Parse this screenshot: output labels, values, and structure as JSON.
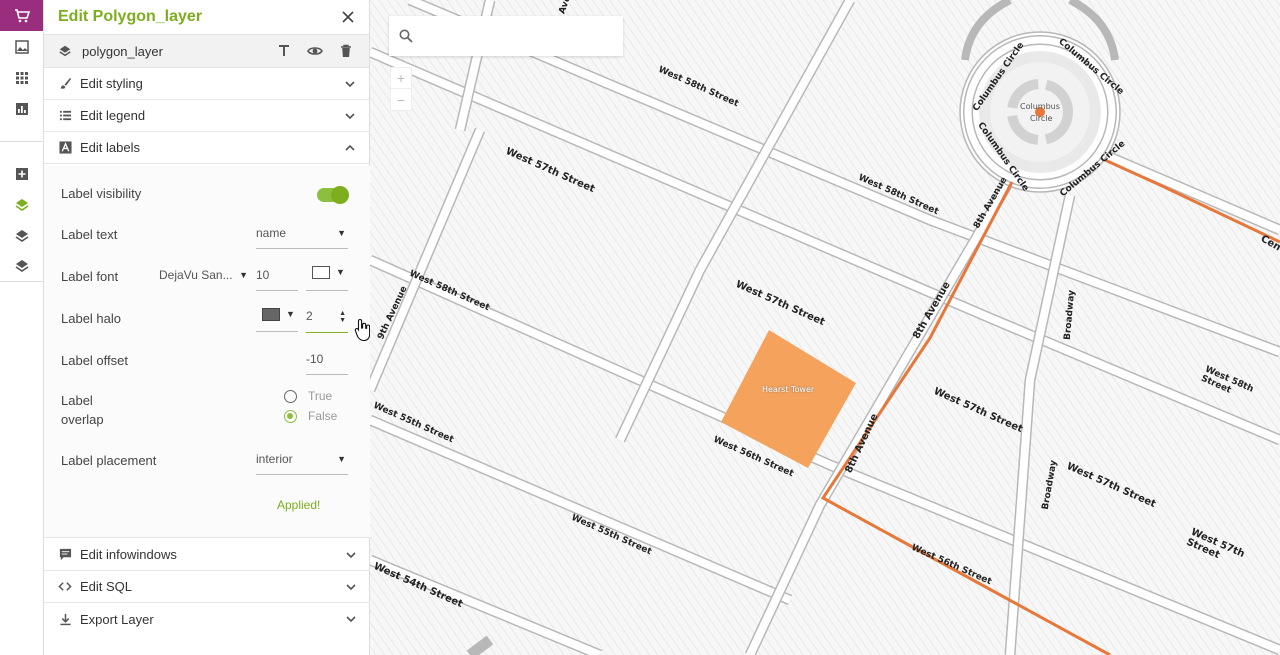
{
  "panel": {
    "title": "Edit Polygon_layer",
    "layer_name": "polygon_layer",
    "sections": {
      "styling": "Edit styling",
      "legend": "Edit legend",
      "labels": "Edit labels",
      "infowindows": "Edit infowindows",
      "sql": "Edit SQL",
      "export": "Export Layer"
    },
    "labels_form": {
      "visibility_label": "Label visibility",
      "text_label": "Label text",
      "text_value": "name",
      "font_label": "Label font",
      "font_family": "DejaVu San...",
      "font_size": "10",
      "halo_label": "Label halo",
      "halo_value": "2",
      "offset_label": "Label offset",
      "offset_value": "-10",
      "overlap_label_1": "Label",
      "overlap_label_2": "overlap",
      "overlap_true": "True",
      "overlap_false": "False",
      "placement_label": "Label placement",
      "placement_value": "interior",
      "status": "Applied!"
    }
  },
  "map": {
    "search_placeholder": "",
    "zoom_in": "+",
    "zoom_out": "−",
    "labels": {
      "w58_a": "West 58th Street",
      "w57_a": "West 57th Street",
      "w58_b": "West 58th Street",
      "w58_c": "West 58th Street",
      "w57_b": "West 57th Street",
      "av9": "9th Avenue",
      "av8_a": "8th Avenue",
      "av8_b": "8th Avenue",
      "av8_c": "8th Avenue",
      "w55_a": "West 55th Street",
      "w56_a": "West 56th Street",
      "w55_b": "West 55th Street",
      "w54": "West 54th Street",
      "w56_b": "West 56th Street",
      "w57_c": "West 57th Street",
      "w57_d": "West 57th Street",
      "w57_e": "West 57th Street",
      "w58_d": "West 58th Street",
      "broadway_a": "Broadway",
      "broadway_b": "Broadway",
      "cc1": "Columbus Circle",
      "cc2": "Columbus Circle",
      "cc3": "Columbus Circle",
      "cc4": "Columbus Circle",
      "cc_center_1": "Columbus",
      "cc_center_2": "Circle",
      "central": "Cen",
      "hearst": "Hearst Tower",
      "ave_top": "Ave"
    }
  },
  "colors": {
    "accent": "#7cae1e",
    "polygon": "#f5a35c",
    "route": "#e8773a",
    "street": "#b0b0b0"
  }
}
